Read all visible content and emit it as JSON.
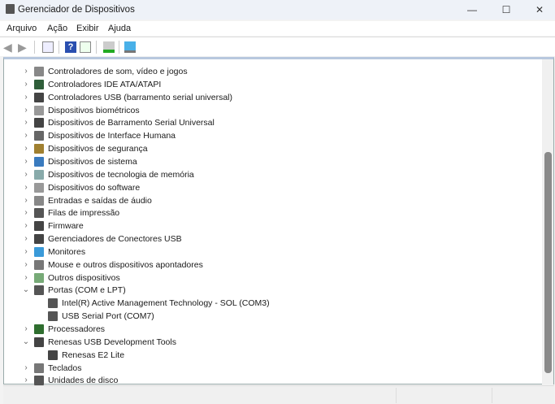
{
  "window": {
    "title": "Gerenciador de Dispositivos",
    "minimize": "—",
    "maximize": "☐",
    "close": "✕"
  },
  "menu": [
    "Arquivo",
    "Ação",
    "Exibir",
    "Ajuda"
  ],
  "toolbar": [
    "back-icon",
    "forward-icon",
    "properties-icon",
    "help-icon",
    "view-icon",
    "update-driver-icon",
    "scan-hardware-icon"
  ],
  "tree": [
    {
      "label": "Controladores de som, vídeo e jogos",
      "level": 0,
      "expanded": false,
      "color": "#888"
    },
    {
      "label": "Controladores IDE ATA/ATAPI",
      "level": 0,
      "expanded": false,
      "color": "#2f5e3a"
    },
    {
      "label": "Controladores USB (barramento serial universal)",
      "level": 0,
      "expanded": false,
      "color": "#444"
    },
    {
      "label": "Dispositivos biométricos",
      "level": 0,
      "expanded": false,
      "color": "#999"
    },
    {
      "label": "Dispositivos de Barramento Serial Universal",
      "level": 0,
      "expanded": false,
      "color": "#444"
    },
    {
      "label": "Dispositivos de Interface Humana",
      "level": 0,
      "expanded": false,
      "color": "#666"
    },
    {
      "label": "Dispositivos de segurança",
      "level": 0,
      "expanded": false,
      "color": "#a08030"
    },
    {
      "label": "Dispositivos de sistema",
      "level": 0,
      "expanded": false,
      "color": "#3a7bbf"
    },
    {
      "label": "Dispositivos de tecnologia de memória",
      "level": 0,
      "expanded": false,
      "color": "#8aa"
    },
    {
      "label": "Dispositivos do software",
      "level": 0,
      "expanded": false,
      "color": "#999"
    },
    {
      "label": "Entradas e saídas de áudio",
      "level": 0,
      "expanded": false,
      "color": "#888"
    },
    {
      "label": "Filas de impressão",
      "level": 0,
      "expanded": false,
      "color": "#555"
    },
    {
      "label": "Firmware",
      "level": 0,
      "expanded": false,
      "color": "#444"
    },
    {
      "label": "Gerenciadores de Conectores USB",
      "level": 0,
      "expanded": false,
      "color": "#444"
    },
    {
      "label": "Monitores",
      "level": 0,
      "expanded": false,
      "color": "#3a9ad9"
    },
    {
      "label": "Mouse e outros dispositivos apontadores",
      "level": 0,
      "expanded": false,
      "color": "#777"
    },
    {
      "label": "Outros dispositivos",
      "level": 0,
      "expanded": false,
      "color": "#7a7"
    },
    {
      "label": "Portas (COM e LPT)",
      "level": 0,
      "expanded": true,
      "color": "#555"
    },
    {
      "label": "Intel(R) Active Management Technology - SOL (COM3)",
      "level": 1,
      "color": "#555"
    },
    {
      "label": "USB Serial Port (COM7)",
      "level": 1,
      "color": "#555"
    },
    {
      "label": "Processadores",
      "level": 0,
      "expanded": false,
      "color": "#2f6e2f"
    },
    {
      "label": "Renesas USB Development Tools",
      "level": 0,
      "expanded": true,
      "color": "#444"
    },
    {
      "label": "Renesas E2 Lite",
      "level": 1,
      "color": "#444"
    },
    {
      "label": "Teclados",
      "level": 0,
      "expanded": false,
      "color": "#777"
    },
    {
      "label": "Unidades de disco",
      "level": 0,
      "expanded": false,
      "color": "#555"
    }
  ]
}
